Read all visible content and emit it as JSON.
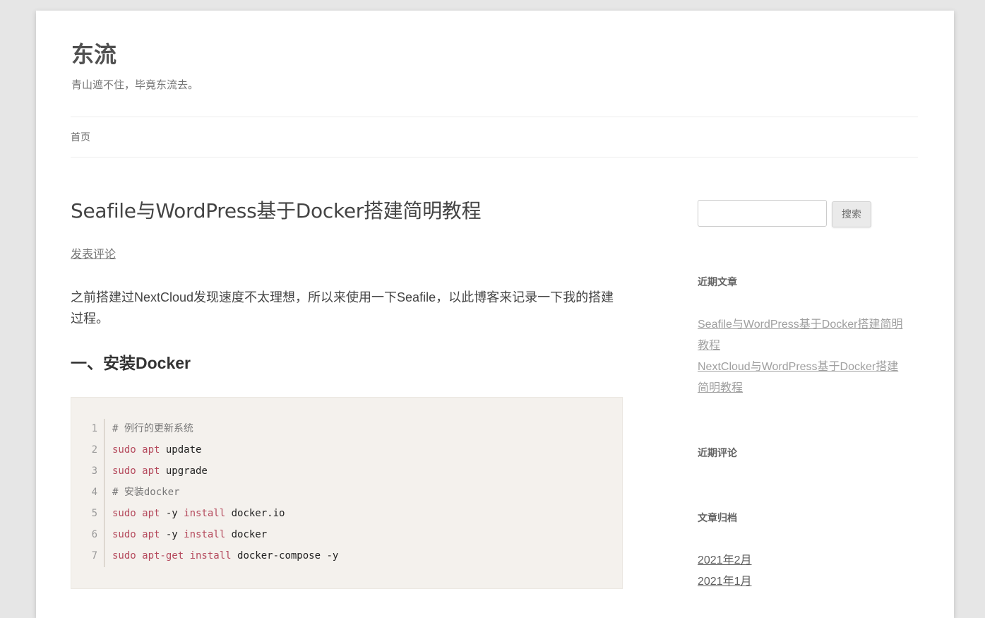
{
  "site": {
    "title": "东流",
    "description": "青山遮不住，毕竟东流去。"
  },
  "nav": {
    "items": [
      {
        "label": "首页"
      }
    ]
  },
  "post": {
    "title": "Seafile与WordPress基于Docker搭建简明教程",
    "comment_link": "发表评论",
    "intro": "之前搭建过NextCloud发现速度不太理想，所以来使用一下Seafile，以此博客来记录一下我的搭建过程。",
    "section_heading": "一、安装Docker",
    "code_lines": [
      {
        "n": "1",
        "parts": [
          {
            "t": "# 例行的更新系统",
            "c": "cm"
          }
        ]
      },
      {
        "n": "2",
        "parts": [
          {
            "t": "sudo apt ",
            "c": "kw"
          },
          {
            "t": "update",
            "c": "plain"
          }
        ]
      },
      {
        "n": "3",
        "parts": [
          {
            "t": "sudo apt ",
            "c": "kw"
          },
          {
            "t": "upgrade",
            "c": "plain"
          }
        ]
      },
      {
        "n": "4",
        "parts": [
          {
            "t": "# 安装docker",
            "c": "cm"
          }
        ]
      },
      {
        "n": "5",
        "parts": [
          {
            "t": "sudo apt ",
            "c": "kw"
          },
          {
            "t": "-y ",
            "c": "plain"
          },
          {
            "t": "install ",
            "c": "kw"
          },
          {
            "t": "docker.io",
            "c": "plain"
          }
        ]
      },
      {
        "n": "6",
        "parts": [
          {
            "t": "sudo apt ",
            "c": "kw"
          },
          {
            "t": "-y ",
            "c": "plain"
          },
          {
            "t": "install ",
            "c": "kw"
          },
          {
            "t": "docker",
            "c": "plain"
          }
        ]
      },
      {
        "n": "7",
        "parts": [
          {
            "t": "sudo apt-get install ",
            "c": "kw"
          },
          {
            "t": "docker-compose -y",
            "c": "plain"
          }
        ]
      }
    ]
  },
  "sidebar": {
    "search": {
      "button_label": "搜索",
      "value": ""
    },
    "recent_posts_title": "近期文章",
    "recent_posts": [
      {
        "line1": "Seafile与WordPress基于Docker搭建简明",
        "line2": "教程"
      },
      {
        "line1": "NextCloud与WordPress基于Docker搭建",
        "line2": "简明教程"
      }
    ],
    "recent_comments_title": "近期评论",
    "archives_title": "文章归档",
    "archives": [
      "2021年2月",
      "2021年1月"
    ]
  },
  "colors": {
    "background": "#e6e6e6",
    "code_background": "#f4f1ed",
    "code_keyword": "#b54a5d",
    "link_muted": "#9f9f9f"
  }
}
